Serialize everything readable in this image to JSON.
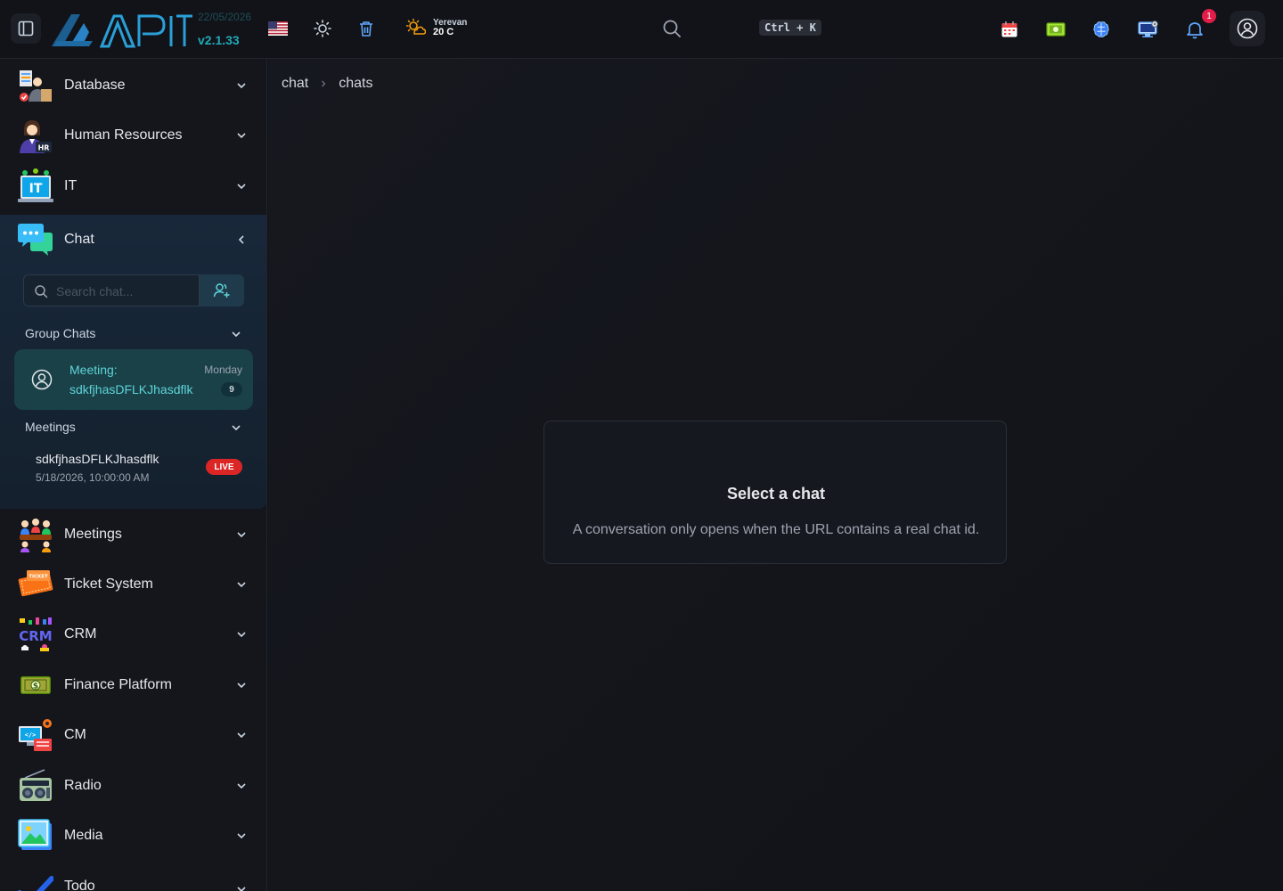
{
  "header": {
    "date": "22/05/2026",
    "version": "v2.1.33",
    "weather": {
      "city": "Yerevan",
      "temp": "20 C"
    },
    "search_shortcut": "Ctrl + K",
    "notification_count": "1"
  },
  "sidebar": {
    "items_top": [
      {
        "label": "Database"
      },
      {
        "label": "Human Resources"
      },
      {
        "label": "IT"
      },
      {
        "label": "Chat"
      }
    ],
    "chat": {
      "search_placeholder": "Search chat...",
      "group_chats_title": "Group Chats",
      "group_chat": {
        "title": "Meeting:",
        "name": "sdkfjhasDFLKJhasdflk",
        "day": "Monday",
        "unread": "9"
      },
      "meetings_title": "Meetings",
      "meeting": {
        "name": "sdkfjhasDFLKJhasdflk",
        "date": "5/18/2026, 10:00:00 AM",
        "status": "LIVE"
      }
    },
    "items_bottom": [
      {
        "label": "Meetings"
      },
      {
        "label": "Ticket System"
      },
      {
        "label": "CRM"
      },
      {
        "label": "Finance Platform"
      },
      {
        "label": "CM"
      },
      {
        "label": "Radio"
      },
      {
        "label": "Media"
      },
      {
        "label": "Todo"
      }
    ]
  },
  "breadcrumb": [
    "chat",
    "chats"
  ],
  "empty_state": {
    "title": "Select a chat",
    "description": "A conversation only opens when the URL contains a real chat id."
  },
  "colors": {
    "accent": "#22a8b8",
    "live": "#dc2626",
    "badge": "#e11d48"
  }
}
